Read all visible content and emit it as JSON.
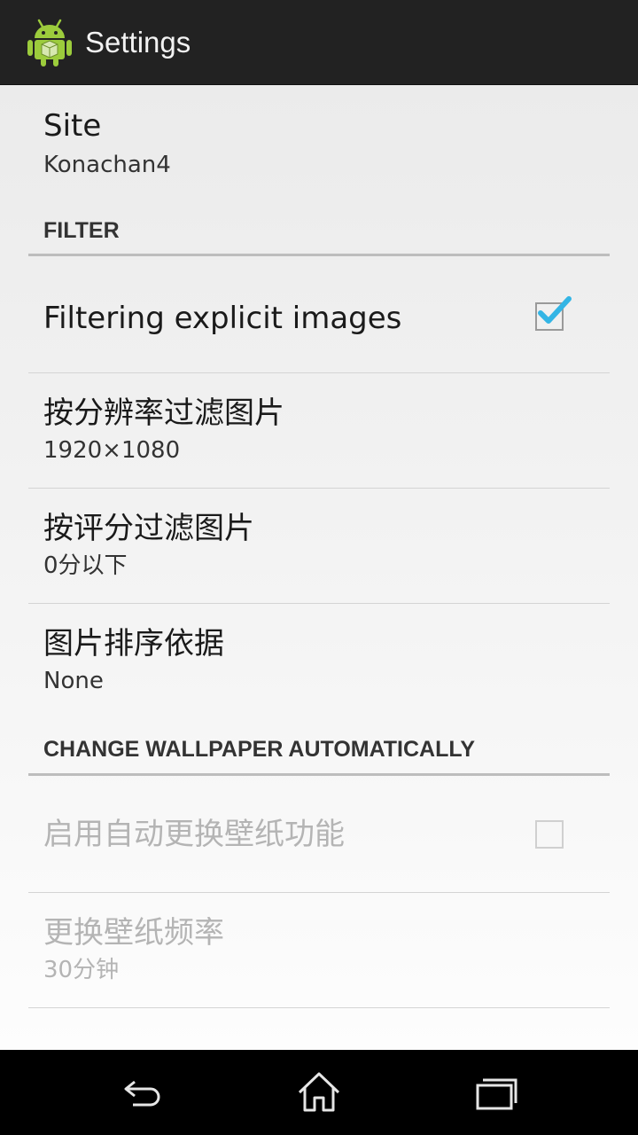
{
  "action_bar": {
    "title": "Settings",
    "app_icon": "android-robot-icon"
  },
  "preferences": {
    "site": {
      "title": "Site",
      "summary": "Konachan4"
    },
    "filter_category": "FILTER",
    "filter_explicit": {
      "title": "Filtering explicit images",
      "checked": true
    },
    "filter_resolution": {
      "title": "按分辨率过滤图片",
      "summary": "1920×1080"
    },
    "filter_rating": {
      "title": "按评分过滤图片",
      "summary": "0分以下"
    },
    "sort_by": {
      "title": "图片排序依据",
      "summary": "None"
    },
    "wallpaper_category": "CHANGE WALLPAPER AUTOMATICALLY",
    "auto_change": {
      "title": "启用自动更换壁纸功能",
      "checked": false,
      "enabled": false
    },
    "change_frequency": {
      "title": "更换壁纸频率",
      "summary": "30分钟",
      "enabled": false
    }
  },
  "navbar": {
    "back": "back-icon",
    "home": "home-icon",
    "recents": "recent-apps-icon"
  },
  "colors": {
    "action_bar": "#222222",
    "checkmark": "#33b5e5",
    "background": "#ebebeb"
  }
}
